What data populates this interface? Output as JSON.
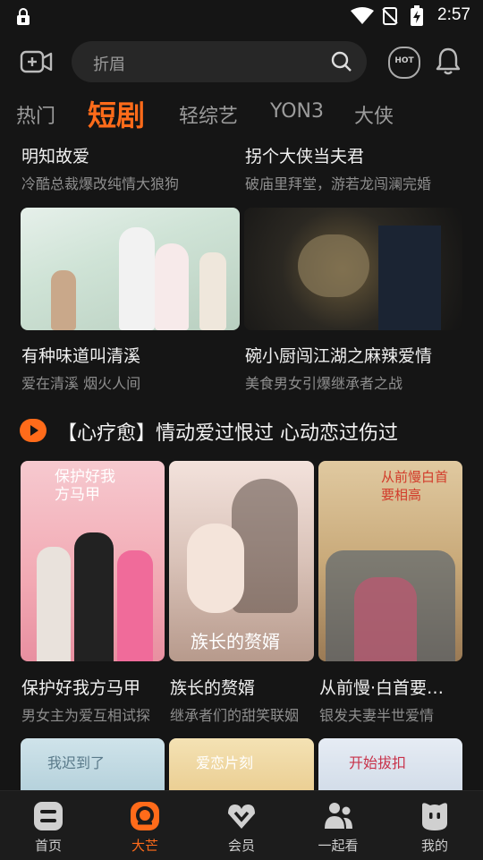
{
  "status": {
    "time": "2:57"
  },
  "search": {
    "placeholder": "折眉",
    "hot_badge": "HOT"
  },
  "tabs": [
    {
      "label": "热门"
    },
    {
      "label": "短剧"
    },
    {
      "label": "轻综艺"
    },
    {
      "label": "YON3"
    },
    {
      "label": "大侠"
    }
  ],
  "row1": [
    {
      "title": "明知故爱",
      "subtitle": "冷酷总裁爆改纯情大狼狗"
    },
    {
      "title": "拐个大侠当夫君",
      "subtitle": "破庙里拜堂，游若龙闯澜完婚"
    }
  ],
  "row2": [
    {
      "title": "有种味道叫清溪",
      "subtitle": "爱在清溪  烟火人间"
    },
    {
      "title": "碗小厨闯江湖之麻辣爱情",
      "subtitle": "美食男女引爆继承者之战"
    }
  ],
  "section": {
    "title": "【心疗愈】情动爱过恨过 心动恋过伤过"
  },
  "row3": [
    {
      "title": "保护好我方马甲",
      "subtitle": "男女主为爱互相试探",
      "poster_text": "保护好我方马甲"
    },
    {
      "title": "族长的赘婿",
      "subtitle": "继承者们的甜笑联姻",
      "poster_text": "族长的赘婿"
    },
    {
      "title": "从前慢·白首要…",
      "subtitle": "银发夫妻半世爱情",
      "poster_text": "从前慢白首要相高"
    }
  ],
  "row4": [
    {
      "poster_text": "我迟到了"
    },
    {
      "poster_text": "爱恋片刻"
    },
    {
      "poster_text": "开始拔扣"
    }
  ],
  "nav": [
    {
      "label": "首页"
    },
    {
      "label": "大芒"
    },
    {
      "label": "会员"
    },
    {
      "label": "一起看"
    },
    {
      "label": "我的"
    }
  ],
  "colors": {
    "accent": "#ff6b1a",
    "background": "#151515"
  }
}
